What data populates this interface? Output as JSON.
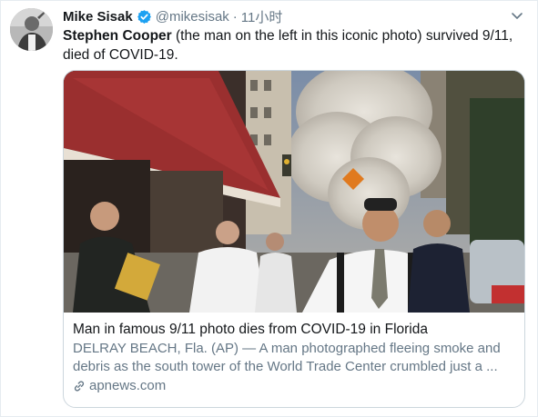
{
  "tweet": {
    "display_name": "Mike Sisak",
    "handle": "@mikesisak",
    "separator": "·",
    "time": "11小时",
    "text_bold": "Stephen Cooper",
    "text_rest": " (the man on the left in this iconic photo) survived 9/11, died of COVID-19.",
    "more_icon": "chevron-down-icon",
    "verified_icon": "verified-badge-icon"
  },
  "card": {
    "title": "Man in famous 9/11 photo dies from COVID-19 in Florida",
    "description": "DELRAY BEACH, Fla. (AP) — A man photographed fleeing smoke and debris as the south tower of the World Trade Center crumbled just a ...",
    "domain": "apnews.com",
    "link_icon": "link-icon"
  },
  "colors": {
    "text": "#14171a",
    "secondary": "#657786",
    "verified": "#1da1f2",
    "border": "#ccd6dd"
  }
}
